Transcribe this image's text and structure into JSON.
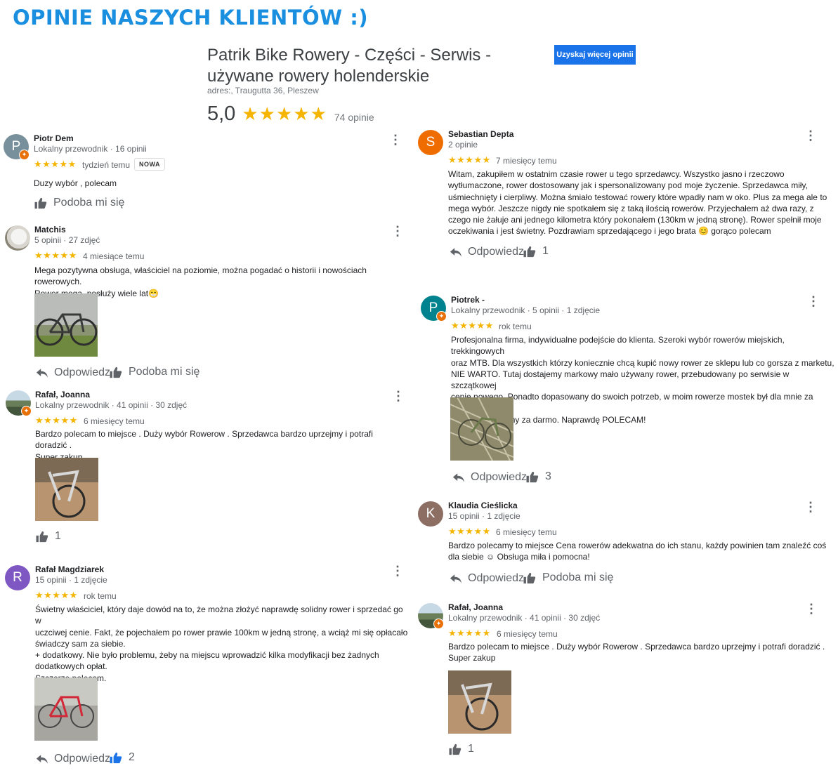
{
  "banner": "OPINIE NASZYCH KLIENTÓW :)",
  "business": {
    "title": "Patrik Bike Rowery - Części - Serwis - używane rowery holenderskie",
    "address": "adres:, Traugutta 36, Pleszew",
    "rating": "5,0",
    "stars": "★★★★★",
    "review_count": "74 opinie",
    "more_button": "Uzyskaj więcej opinii"
  },
  "labels": {
    "reply": "Odpowiedz",
    "like": "Podoba mi się",
    "new_tag": "NOWA"
  },
  "colors": {
    "star": "#f4b400",
    "button": "#1a73e8",
    "banner": "#1a8fe0",
    "liked": "#1a73e8"
  },
  "reviews": [
    {
      "avatar_letter": "P",
      "avatar_color": "#78909c",
      "local_guide": true,
      "name": "Piotr Dem",
      "meta": "Lokalny przewodnik · 16 opinii",
      "stars": "★★★★★",
      "time": "tydzień temu",
      "is_new": true,
      "text": "Duzy wybór , polecam",
      "likes": "Podoba mi się"
    },
    {
      "avatar_letter": "",
      "avatar_color": "photo-dog",
      "local_guide": false,
      "name": "Matchis",
      "meta": "5 opinii · 27 zdjęć",
      "stars": "★★★★★",
      "time": "4 miesiące temu",
      "text": "Mega pozytywna obsługa, właściciel na poziomie, można pogadać o historii i nowościach rowerowych.\nRower mega, posłuży wiele lat😁",
      "likes": "Podoba mi się"
    },
    {
      "avatar_letter": "",
      "avatar_color": "photo-land",
      "local_guide": true,
      "name": "Rafał, Joanna",
      "meta": "Lokalny przewodnik · 41 opinii · 30 zdjęć",
      "stars": "★★★★★",
      "time": "6 miesięcy temu",
      "text": "Bardzo polecam to miejsce . Duży wybór Rowerow . Sprzedawca bardzo uprzejmy i potrafi doradzić .\nSuper zakup",
      "likes": "1"
    },
    {
      "avatar_letter": "R",
      "avatar_color": "#7e57c2",
      "local_guide": false,
      "name": "Rafał Magdziarek",
      "meta": "15 opinii · 1 zdjęcie",
      "stars": "★★★★★",
      "time": "rok temu",
      "text": "Świetny właściciel, który daje dowód na to, że można złożyć naprawdę solidny rower i sprzedać go w\nuczciwej cenie. Fakt, że pojechałem po rower prawie 100km w jedną stronę, a wciąż mi się opłacało\nświadczy sam za siebie.\n+ dodatkowy. Nie było problemu, żeby na miejscu wprowadzić kilka modyfikacji bez żadnych\ndodatkowych opłat.\nSzczerze polecam.",
      "likes": "2"
    },
    {
      "avatar_letter": "S",
      "avatar_color": "#ef6c00",
      "local_guide": false,
      "name": "Sebastian Depta",
      "meta": "2 opinie",
      "stars": "★★★★★",
      "time": "7 miesięcy temu",
      "text": "Witam, zakupiłem w ostatnim czasie rower u tego sprzedawcy. Wszystko jasno i rzeczowo\nwytłumaczone, rower dostosowany  jak i spersonalizowany pod moje życzenie. Sprzedawca miły,\nuśmiechnięty i cierpliwy. Można śmiało testować rowery które wpadły nam w oko. Plus za mega ale to\nmega wybór. Jeszcze nigdy nie spotkałem się z taką ilością rowerów. Przyjechałem aż dwa razy, z\nczego nie żałuje ani jednego kilometra który pokonałem (130km w jedną stronę). Rower spełnił moje\noczekiwania i jest świetny. Pozdrawiam sprzedającego i jego brata 😊 gorąco polecam",
      "likes": "1"
    },
    {
      "avatar_letter": "P",
      "avatar_color": "#00838f",
      "local_guide": true,
      "name": "Piotrek -",
      "meta": "Lokalny przewodnik · 5 opinii · 1 zdjęcie",
      "stars": "★★★★★",
      "time": "rok temu",
      "text": "Profesjonalna firma, indywidualne podejście do klienta. Szeroki wybór rowerów miejskich, trekkingowych\noraz MTB. Dla wszystkich którzy koniecznie chcą kupić nowy rower ze sklepu lub co gorsza z marketu,\nNIE WARTO. Tutaj dostajemy markowy mało używany rower, przebudowany po serwisie w szczątkowej\ncenie nowego. Ponadto dopasowany do swoich potrzeb, w moim rowerze mostek był dla mnie za krótki\nzostał wymieniony za darmo. Naprawdę POLECAM!",
      "likes": "3"
    },
    {
      "avatar_letter": "K",
      "avatar_color": "#8d6e63",
      "local_guide": false,
      "name": "Klaudia Cieślicka",
      "meta": "15 opinii · 1 zdjęcie",
      "stars": "★★★★★",
      "time": "6 miesięcy temu",
      "text": "Bardzo polecamy to miejsce    Cena rowerów adekwatna do ich stanu, każdy powinien tam znaleźć coś\ndla siebie ☺ Obsługa miła i pomocna!",
      "likes": "Podoba mi się"
    },
    {
      "avatar_letter": "",
      "avatar_color": "photo-land",
      "local_guide": true,
      "name": "Rafał, Joanna",
      "meta": "Lokalny przewodnik · 41 opinii · 30 zdjęć",
      "stars": "★★★★★",
      "time": "6 miesięcy temu",
      "text": "Bardzo polecam to miejsce . Duży wybór Rowerow . Sprzedawca bardzo uprzejmy i potrafi doradzić .\nSuper zakup",
      "likes": "1"
    }
  ]
}
